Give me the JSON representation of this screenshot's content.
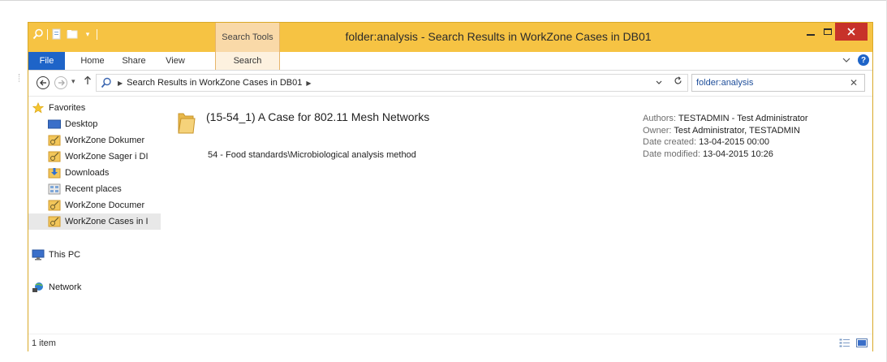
{
  "window": {
    "title": "folder:analysis - Search Results in WorkZone Cases in DB01",
    "context_tab_group": "Search Tools",
    "accent_color": "#f6c343"
  },
  "ribbon": {
    "tabs": [
      {
        "label": "File",
        "active": false
      },
      {
        "label": "Home",
        "active": false
      },
      {
        "label": "Share",
        "active": false
      },
      {
        "label": "View",
        "active": false
      },
      {
        "label": "Search",
        "active": true
      }
    ]
  },
  "address": {
    "path": "Search Results in WorkZone Cases in DB01"
  },
  "search": {
    "value": "folder:analysis"
  },
  "nav_pane": {
    "favorites_label": "Favorites",
    "favorites": [
      {
        "label": "Desktop",
        "icon": "desktop-icon"
      },
      {
        "label": "WorkZone Dokumer",
        "icon": "workzone-icon"
      },
      {
        "label": "WorkZone Sager i DI",
        "icon": "workzone-icon"
      },
      {
        "label": "Downloads",
        "icon": "downloads-icon"
      },
      {
        "label": "Recent places",
        "icon": "recent-places-icon"
      },
      {
        "label": "WorkZone Documer",
        "icon": "workzone-icon"
      },
      {
        "label": "WorkZone Cases in I",
        "icon": "workzone-icon",
        "selected": true
      }
    ],
    "this_pc": "This PC",
    "network": "Network"
  },
  "results": {
    "items": [
      {
        "name": "(15-54_1) A Case for 802.11 Mesh Networks",
        "path": "54 - Food standards\\Microbiological analysis method",
        "authors_label": "Authors:",
        "authors": "TESTADMIN - Test Administrator",
        "owner_label": "Owner:",
        "owner": "Test Administrator, TESTADMIN",
        "created_label": "Date created:",
        "created": "13-04-2015 00:00",
        "modified_label": "Date modified:",
        "modified": "13-04-2015 10:26"
      }
    ]
  },
  "status": {
    "count": "1 item"
  }
}
